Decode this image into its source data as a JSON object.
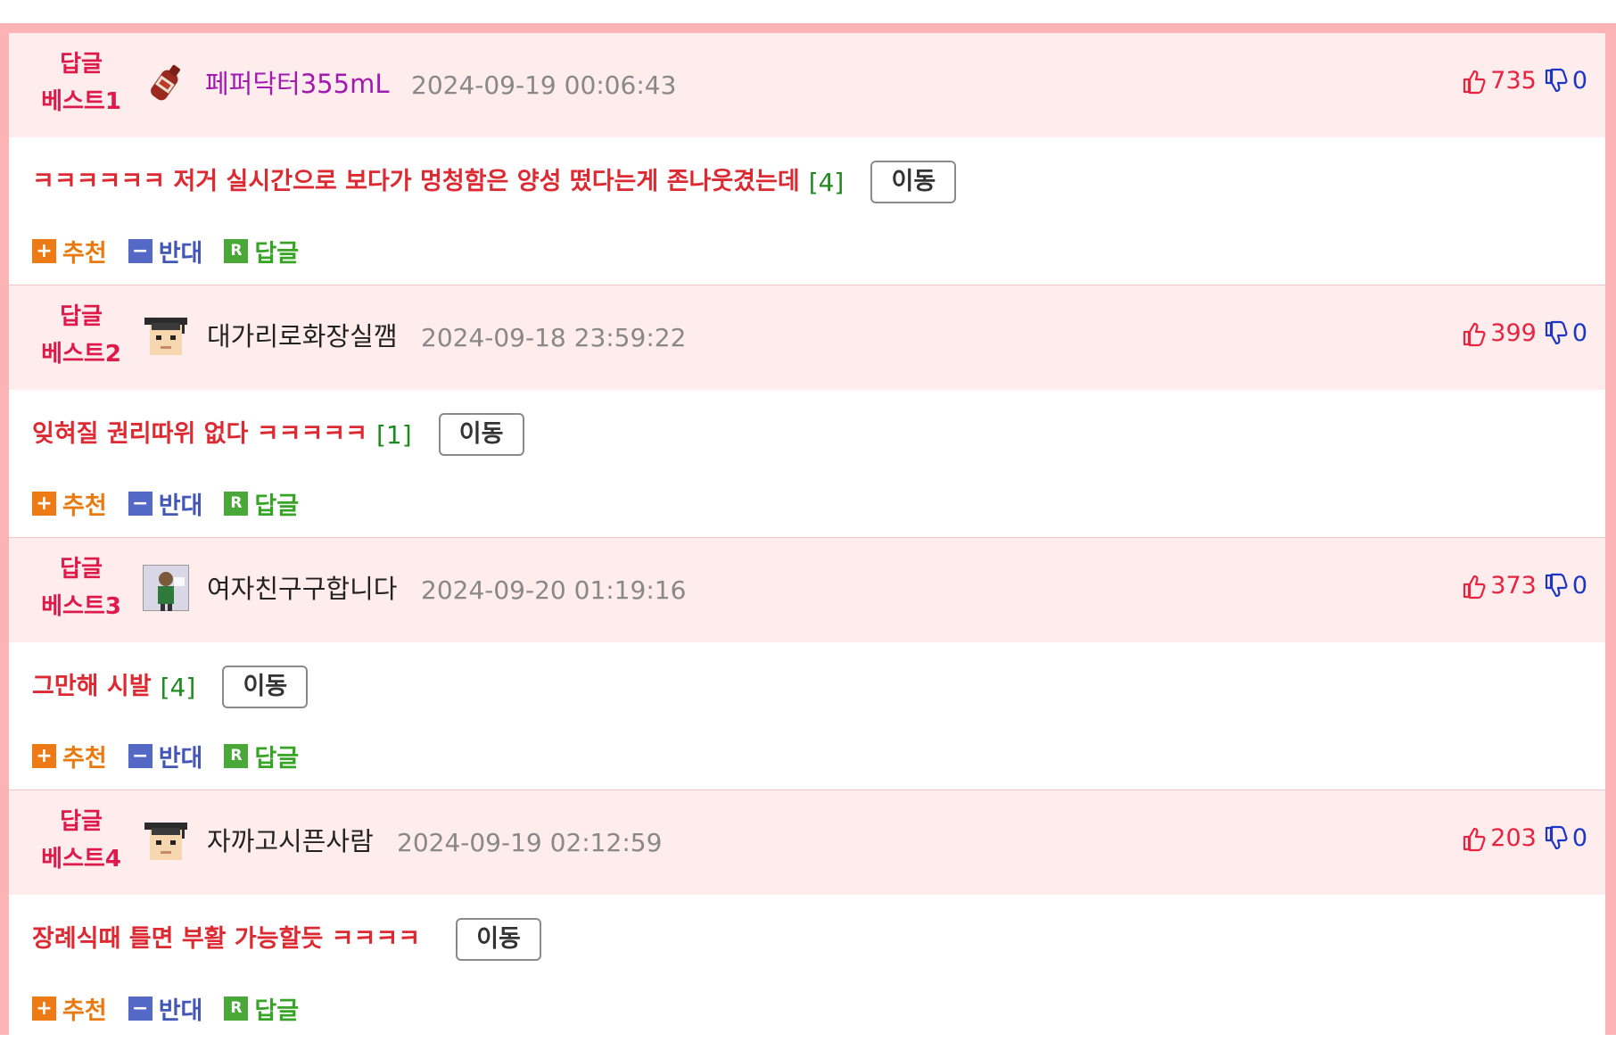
{
  "colors": {
    "frame": "#fbb3b5",
    "header_bg": "#ffecec",
    "badge": "#dd1a4b",
    "comment_text": "#dd2a32",
    "reply_count": "#1f8a1f",
    "up": "#e8233f",
    "down": "#1b35c4"
  },
  "actions": {
    "recommend_label": "추천",
    "oppose_label": "반대",
    "reply_label": "답글",
    "move_label": "이동"
  },
  "comments": [
    {
      "badge_line1": "답글",
      "badge_line2": "베스트1",
      "avatar_icon": "soda-bottle-icon",
      "nickname": "페퍼닥터355mL",
      "date": "2024-09-19 00:06:43",
      "upvotes": "735",
      "downvotes": "0",
      "text": "ㅋㅋㅋㅋㅋㅋ 저거 실시간으로 보다가 멍청함은 양성 떴다는게 존나웃겼는데",
      "reply_count": "[4]"
    },
    {
      "badge_line1": "답글",
      "badge_line2": "베스트2",
      "avatar_icon": "graduate-avatar-icon",
      "nickname": "대가리로화장실깸",
      "date": "2024-09-18 23:59:22",
      "upvotes": "399",
      "downvotes": "0",
      "text": "잊혀질 권리따위 없다 ㅋㅋㅋㅋㅋ",
      "reply_count": "[1]"
    },
    {
      "badge_line1": "답글",
      "badge_line2": "베스트3",
      "avatar_icon": "character-photo-icon",
      "nickname": "여자친구구합니다",
      "date": "2024-09-20 01:19:16",
      "upvotes": "373",
      "downvotes": "0",
      "text": "그만해 시발",
      "reply_count": "[4]"
    },
    {
      "badge_line1": "답글",
      "badge_line2": "베스트4",
      "avatar_icon": "graduate-avatar-icon",
      "nickname": "자까고시픈사람",
      "date": "2024-09-19 02:12:59",
      "upvotes": "203",
      "downvotes": "0",
      "text": "장례식때 틀면 부활 가능할듯 ㅋㅋㅋㅋ",
      "reply_count": ""
    }
  ]
}
